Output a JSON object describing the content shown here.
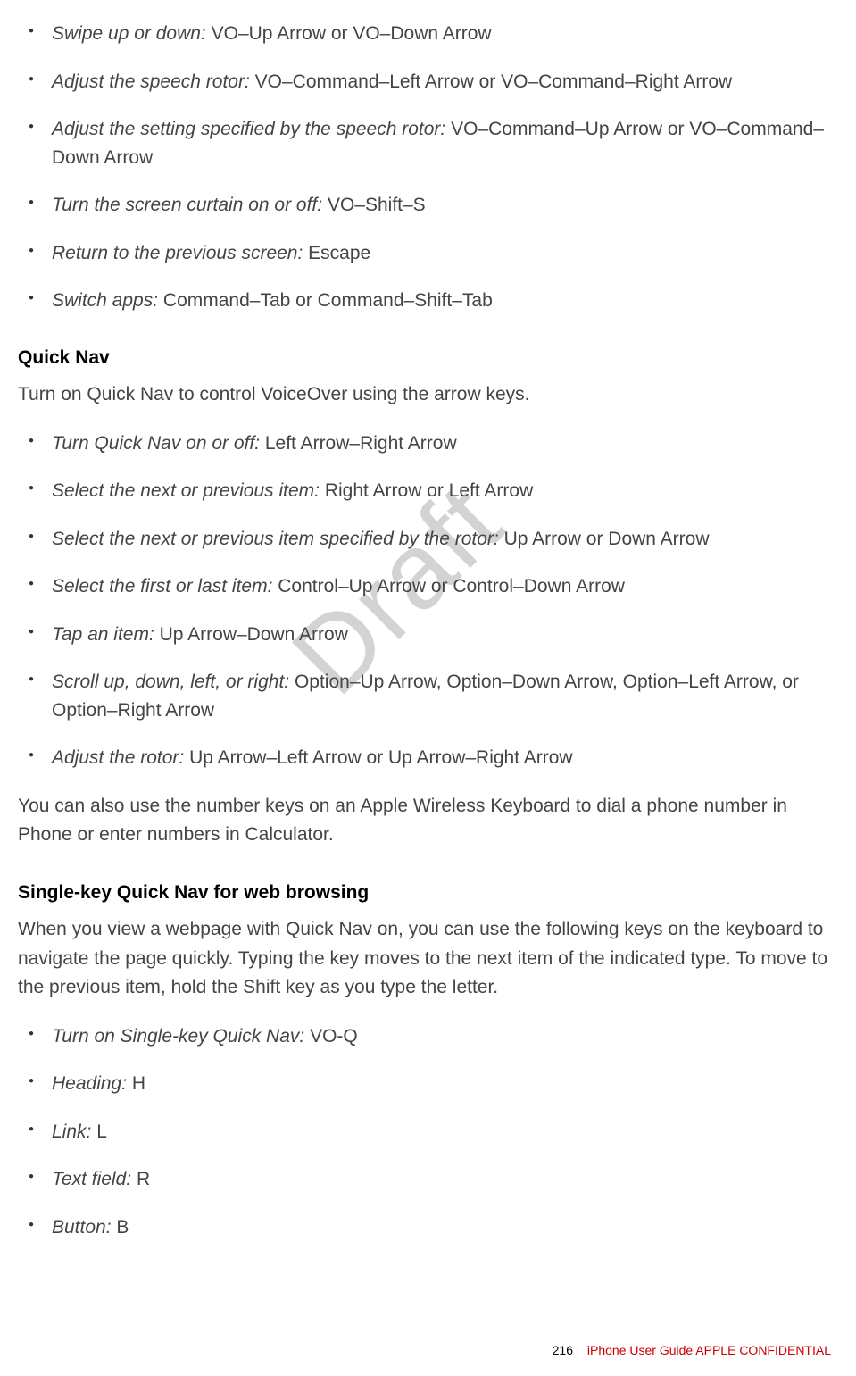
{
  "watermark": "Draft",
  "sections": [
    {
      "heading": null,
      "intro": null,
      "items": [
        {
          "label": "Swipe up or down:",
          "value": " VO–Up Arrow or VO–Down Arrow"
        },
        {
          "label": "Adjust the speech rotor:",
          "value": " VO–Command–Left Arrow or VO–Command–Right Arrow"
        },
        {
          "label": "Adjust the setting specified by the speech rotor:",
          "value": " VO–Command–Up Arrow or VO–Command–Down Arrow"
        },
        {
          "label": "Turn the screen curtain on or off:",
          "value": " VO–Shift–S"
        },
        {
          "label": "Return to the previous screen:",
          "value": " Escape"
        },
        {
          "label": "Switch apps:",
          "value": " Command–Tab or Command–Shift–Tab"
        }
      ],
      "outro": null
    },
    {
      "heading": "Quick Nav",
      "intro": "Turn on Quick Nav to control VoiceOver using the arrow keys.",
      "items": [
        {
          "label": "Turn Quick Nav on or off:",
          "value": " Left Arrow–Right Arrow"
        },
        {
          "label": "Select the next or previous item:",
          "value": " Right Arrow or Left Arrow"
        },
        {
          "label": "Select the next or previous item specified by the rotor:",
          "value": " Up Arrow or Down Arrow"
        },
        {
          "label": "Select the first or last item:",
          "value": " Control–Up Arrow or Control–Down Arrow"
        },
        {
          "label": "Tap an item:",
          "value": " Up Arrow–Down Arrow"
        },
        {
          "label": "Scroll up, down, left, or right:",
          "value": " Option–Up Arrow, Option–Down Arrow, Option–Left Arrow, or Option–Right Arrow"
        },
        {
          "label": "Adjust the rotor:",
          "value": " Up Arrow–Left Arrow or Up Arrow–Right Arrow"
        }
      ],
      "outro": "You can also use the number keys on an Apple Wireless Keyboard to dial a phone number in Phone or enter numbers in Calculator."
    },
    {
      "heading": "Single-key Quick Nav for web browsing",
      "intro": "When you view a webpage with Quick Nav on, you can use the following keys on the keyboard to navigate the page quickly. Typing the key moves to the next item of the indicated type. To move to the previous item, hold the Shift key as you type the letter.",
      "items": [
        {
          "label": "Turn on Single-key Quick Nav:",
          "value": " VO-Q"
        },
        {
          "label": "Heading:",
          "value": " H"
        },
        {
          "label": "Link:",
          "value": " L"
        },
        {
          "label": "Text field:",
          "value": " R"
        },
        {
          "label": "Button:",
          "value": " B"
        }
      ],
      "outro": null
    }
  ],
  "footer": {
    "page": "216",
    "text": "iPhone User Guide  APPLE CONFIDENTIAL"
  }
}
